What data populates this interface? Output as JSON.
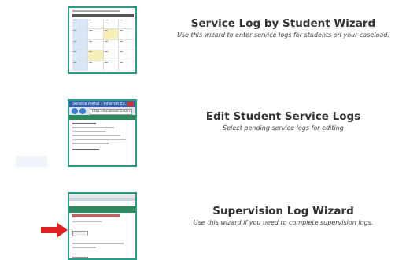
{
  "items": [
    {
      "title": "Service Log by Student Wizard",
      "subtitle": "Use this wizard to enter service logs for students on your caseload."
    },
    {
      "title": "Edit Student Service Logs",
      "subtitle": "Select pending service logs for editing"
    },
    {
      "title": "Supervision Log Wizard",
      "subtitle": "Use this wizard if you need to complete supervision logs."
    }
  ],
  "thumb2": {
    "window_title": "Service Portal - Internet Ex...",
    "address": "http://localhost:1907/Dis..."
  },
  "colors": {
    "thumb_border": "#2a9d8a",
    "arrow": "#e02020"
  },
  "icons": {
    "pointer": "arrow-right-icon"
  }
}
